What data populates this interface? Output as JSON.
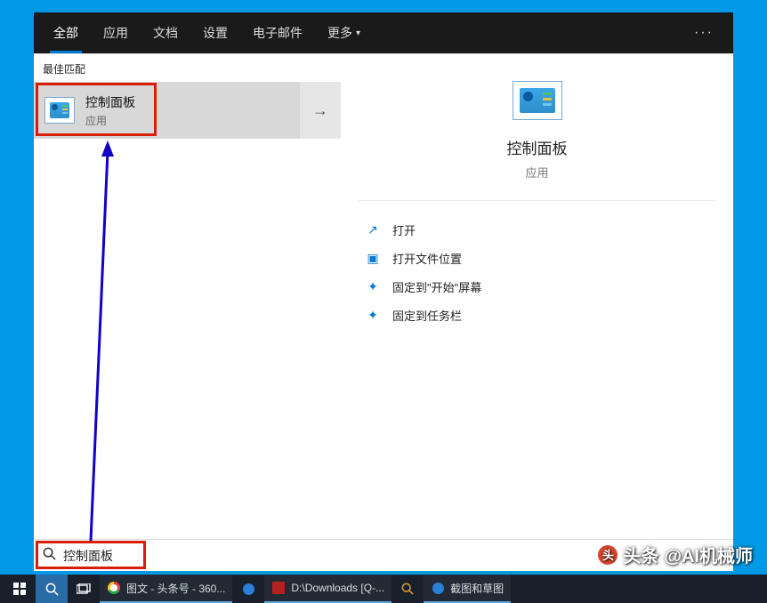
{
  "tabs": {
    "items": [
      "全部",
      "应用",
      "文档",
      "设置",
      "电子邮件"
    ],
    "more": "更多",
    "activeIndex": 0
  },
  "left": {
    "sectionLabel": "最佳匹配",
    "result": {
      "title": "控制面板",
      "subtitle": "应用"
    }
  },
  "detail": {
    "title": "控制面板",
    "subtitle": "应用",
    "actions": [
      {
        "icon": "open",
        "label": "打开"
      },
      {
        "icon": "folder",
        "label": "打开文件位置"
      },
      {
        "icon": "pin",
        "label": "固定到\"开始\"屏幕"
      },
      {
        "icon": "pin",
        "label": "固定到任务栏"
      }
    ]
  },
  "search": {
    "value": "控制面板"
  },
  "taskbar": {
    "apps": [
      {
        "icon": "chrome",
        "label": "图文 - 头条号 - 360..."
      },
      {
        "icon": "blueball",
        "label": ""
      },
      {
        "icon": "redsq",
        "label": "D:\\Downloads  [Q-..."
      },
      {
        "icon": "search",
        "label": ""
      },
      {
        "icon": "blueball",
        "label": "截图和草图"
      }
    ]
  },
  "watermark": {
    "prefix": "头条",
    "text": "@AI机械师"
  }
}
